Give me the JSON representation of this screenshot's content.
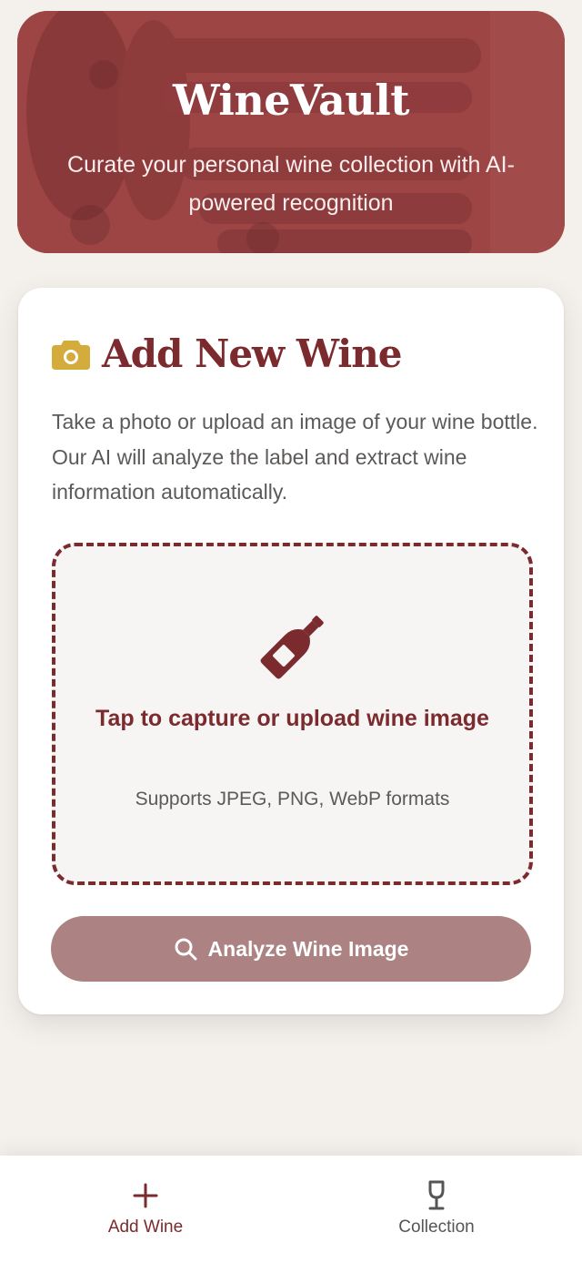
{
  "hero": {
    "title": "WineVault",
    "subtitle": "Curate your personal wine collection with AI-powered recognition"
  },
  "add_wine_card": {
    "icon": "camera-icon",
    "title": "Add New Wine",
    "description": "Take a photo or upload an image of your wine bottle. Our AI will analyze the label and extract wine information automatically.",
    "upload": {
      "icon": "wine-bottle-icon",
      "title": "Tap to capture or upload wine image",
      "hint": "Supports JPEG, PNG, WebP formats"
    },
    "analyze_button": {
      "icon": "search-icon",
      "label": "Analyze Wine Image"
    }
  },
  "bottom_nav": {
    "items": [
      {
        "icon": "plus-icon",
        "label": "Add Wine",
        "active": true
      },
      {
        "icon": "wine-glass-icon",
        "label": "Collection",
        "active": false
      }
    ]
  },
  "colors": {
    "primary": "#7b2a2e",
    "accent_gold": "#d4ac3c",
    "button_disabled": "#ac8283",
    "background": "#f4f1ed"
  }
}
